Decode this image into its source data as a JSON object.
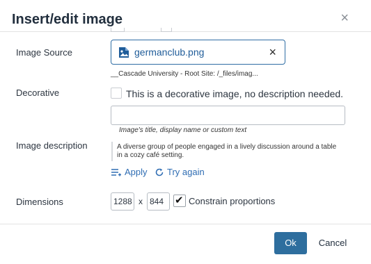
{
  "dialog": {
    "title": "Insert/edit image",
    "close_glyph": "×"
  },
  "image_source": {
    "label": "Image Source",
    "file_name": "germanclub.png",
    "file_icon": "image-file-icon",
    "clear_glyph": "×",
    "path": "__Cascade University - Root Site: /_files/imag..."
  },
  "decorative": {
    "label": "Decorative",
    "checkbox_text": "This is a decorative image, no description needed.",
    "checked": false
  },
  "image_title": {
    "value": "",
    "hint": "Image's title, display name or custom text"
  },
  "image_description": {
    "label": "Image description",
    "text": "A diverse group of people engaged in a lively discussion around a table in a cozy café setting.",
    "apply_label": "Apply",
    "try_again_label": "Try again"
  },
  "dimensions": {
    "label": "Dimensions",
    "width": "1288",
    "separator": "x",
    "height": "844",
    "constrain_label": "Constrain proportions",
    "constrain_checked": true
  },
  "footer": {
    "ok_label": "Ok",
    "cancel_label": "Cancel"
  },
  "colors": {
    "primary": "#2e6e9e",
    "link": "#2f6db3",
    "file_link": "#1f5c99"
  }
}
